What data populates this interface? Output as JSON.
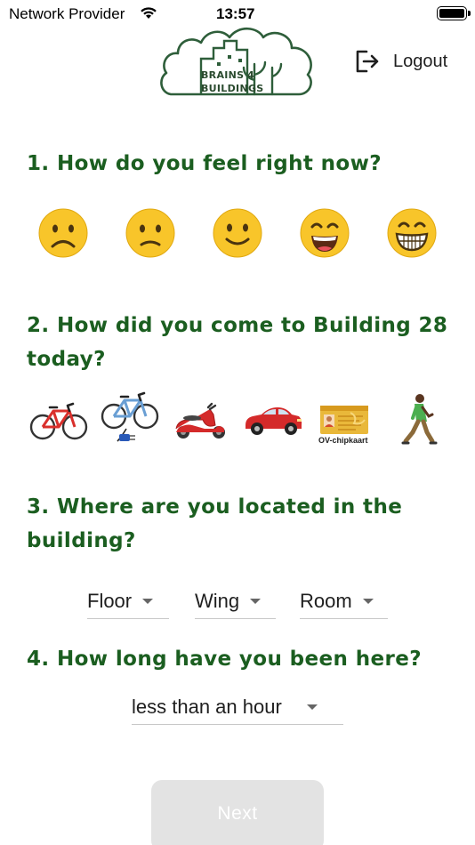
{
  "status_bar": {
    "carrier": "Network Provider",
    "time": "13:57"
  },
  "header": {
    "logo_line1": "BRAINS",
    "logo_number": "4",
    "logo_line2": "BUILDINGS",
    "logout_label": "Logout",
    "logout_icon": "logout-icon"
  },
  "questions": {
    "q1": "1. How do you feel right now?",
    "q2": "2. How did you come to Building 28 today?",
    "q3": "3. Where are you located in the building?",
    "q4": "4. How long have you been here?"
  },
  "moods": [
    {
      "icon": "frowning-face-icon"
    },
    {
      "icon": "slightly-frowning-face-icon"
    },
    {
      "icon": "slightly-smiling-face-icon"
    },
    {
      "icon": "grinning-face-icon"
    },
    {
      "icon": "beaming-face-icon"
    }
  ],
  "transport": {
    "options": [
      {
        "icon": "bicycle-icon"
      },
      {
        "icon": "e-bike-icon"
      },
      {
        "icon": "scooter-icon"
      },
      {
        "icon": "car-icon"
      },
      {
        "icon": "public-transport-card-icon",
        "caption": "OV-chipkaart"
      },
      {
        "icon": "walking-person-icon"
      }
    ]
  },
  "location": {
    "floor": "Floor",
    "wing": "Wing",
    "room": "Room"
  },
  "duration": {
    "value": "less than an hour"
  },
  "next_label": "Next",
  "colors": {
    "question_text": "#1b5e20",
    "logo_green": "#2e5e3a",
    "button_disabled": "#e3e3e3",
    "emoji_yellow": "#f8c52a"
  }
}
